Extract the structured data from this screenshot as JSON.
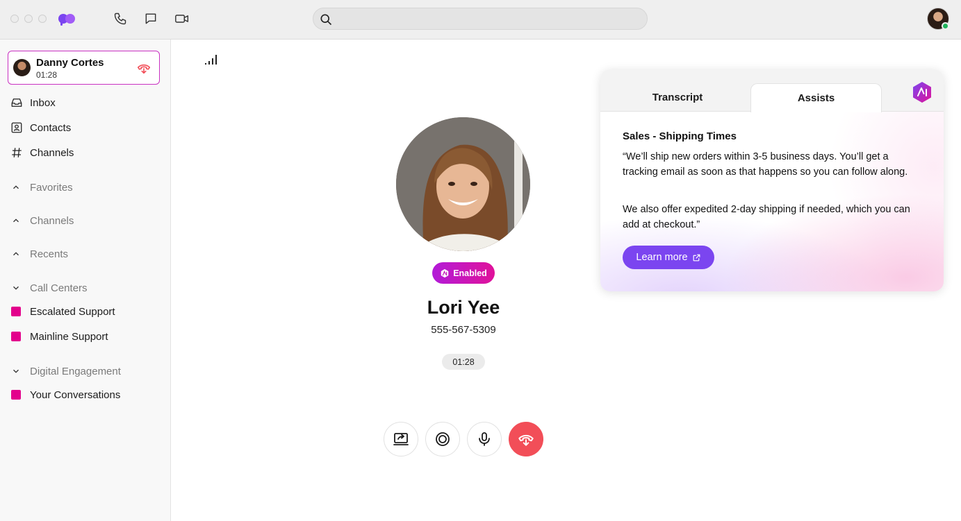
{
  "app": {
    "search": {
      "placeholder": "",
      "value": ""
    }
  },
  "colors": {
    "accent": "#7b45f0",
    "brand": "#c930c2",
    "hangup": "#f24e58",
    "tag": "#e3008c"
  },
  "active_call": {
    "name": "Danny Cortes",
    "duration": "01:28"
  },
  "sidebar": {
    "nav": [
      {
        "label": "Inbox",
        "icon": "inbox-icon"
      },
      {
        "label": "Contacts",
        "icon": "contacts-icon"
      },
      {
        "label": "Channels",
        "icon": "hash-icon"
      }
    ],
    "sections": {
      "favorites": "Favorites",
      "channels": "Channels",
      "recents": "Recents",
      "call_centers": "Call Centers",
      "digital_engagement": "Digital Engagement"
    },
    "call_centers": [
      "Escalated Support",
      "Mainline Support"
    ],
    "digital_engagement": [
      "Your Conversations"
    ]
  },
  "caller": {
    "badge": "Enabled",
    "name": "Lori Yee",
    "phone": "555-567-5309",
    "timer": "01:28"
  },
  "assist_panel": {
    "tabs": [
      "Transcript",
      "Assists"
    ],
    "active_tab": "Assists",
    "title": "Sales - Shipping Times",
    "paragraphs": [
      "“We’ll ship new orders within 3-5 business days. You’ll get a tracking email as soon as that happens so you can follow along.",
      "We also offer expedited 2-day shipping if needed, which you can add at checkout.”"
    ],
    "button": "Learn more"
  }
}
